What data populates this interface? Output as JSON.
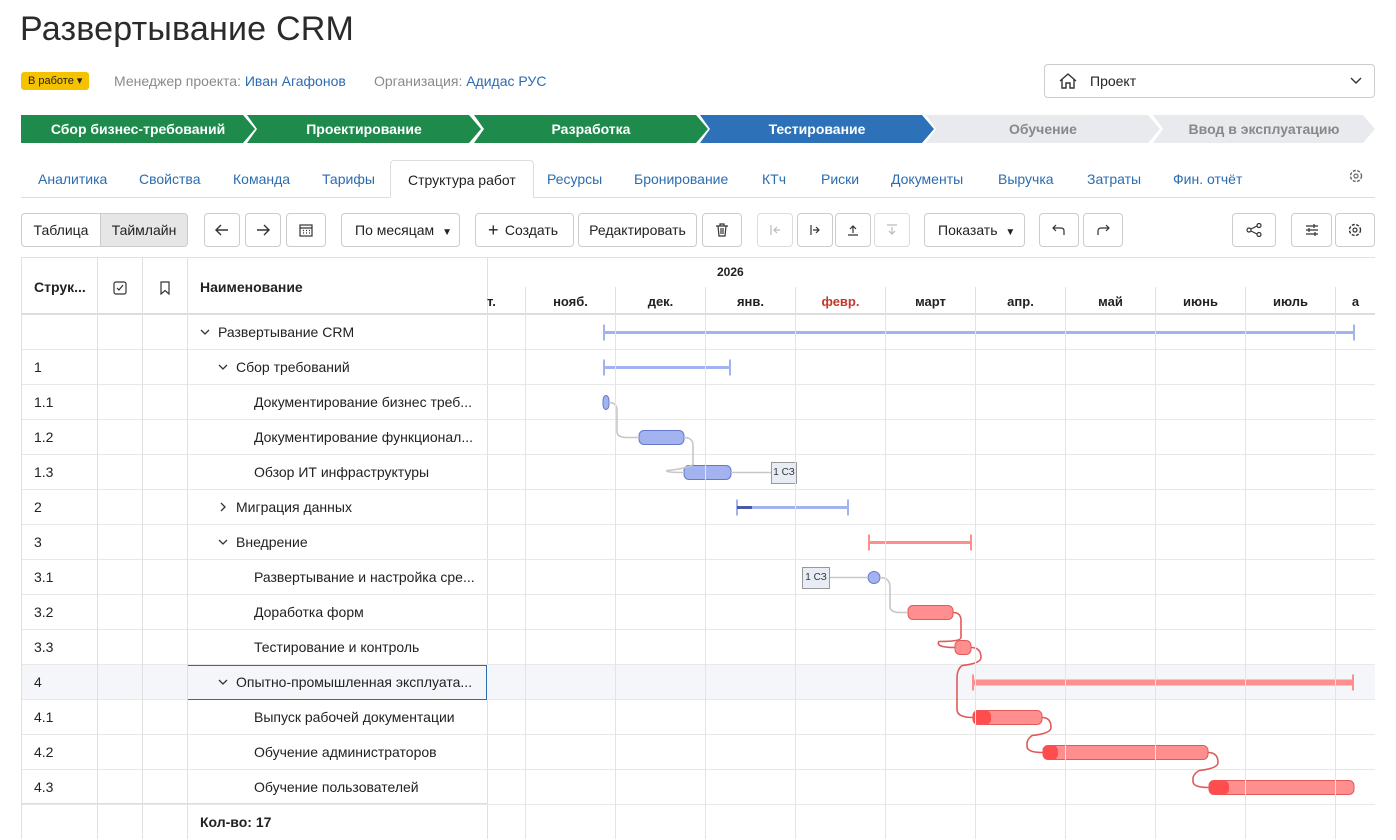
{
  "header": {
    "title": "Развертывание CRM",
    "status": "В работе",
    "manager_label": "Менеджер проекта:",
    "manager_name": "Иван Агафонов",
    "org_label": "Организация:",
    "org_name": "Адидас РУС",
    "project_select": "Проект"
  },
  "stages": [
    {
      "label": "Сбор бизнес-требований",
      "color": "#1e8a4c"
    },
    {
      "label": "Проектирование",
      "color": "#1e8a4c"
    },
    {
      "label": "Разработка",
      "color": "#1e8a4c"
    },
    {
      "label": "Тестирование",
      "color": "#2d72b8"
    },
    {
      "label": "Обучение",
      "color": "#e8eaed"
    },
    {
      "label": "Ввод в эксплуатацию",
      "color": "#e8eaed"
    }
  ],
  "tabs": [
    "Аналитика",
    "Свойства",
    "Команда",
    "Тарифы",
    "Структура работ",
    "Ресурсы",
    "Бронирование",
    "КТч",
    "Риски",
    "Документы",
    "Выручка",
    "Затраты",
    "Фин. отчёт"
  ],
  "active_tab": "Структура работ",
  "toolbar": {
    "view_table": "Таблица",
    "view_timeline": "Таймлайн",
    "scale": "По месяцам",
    "create": "Создать",
    "edit": "Редактировать",
    "show": "Показать"
  },
  "grid": {
    "col_struct": "Струк...",
    "col_name": "Наименование",
    "footer": "Кол-во: 17",
    "rows": [
      {
        "num": "",
        "name": "Развертывание CRM",
        "level": 0,
        "caret": "down"
      },
      {
        "num": "1",
        "name": "Сбор требований",
        "level": 1,
        "caret": "down"
      },
      {
        "num": "1.1",
        "name": "Документирование бизнес треб...",
        "level": 2,
        "caret": ""
      },
      {
        "num": "1.2",
        "name": "Документирование функционал...",
        "level": 2,
        "caret": ""
      },
      {
        "num": "1.3",
        "name": "Обзор ИТ инфраструктуры",
        "level": 2,
        "caret": ""
      },
      {
        "num": "2",
        "name": "Миграция данных",
        "level": 1,
        "caret": "right"
      },
      {
        "num": "3",
        "name": "Внедрение",
        "level": 1,
        "caret": "down"
      },
      {
        "num": "3.1",
        "name": "Развертывание и настройка сре...",
        "level": 2,
        "caret": ""
      },
      {
        "num": "3.2",
        "name": "Доработка форм",
        "level": 2,
        "caret": ""
      },
      {
        "num": "3.3",
        "name": "Тестирование и контроль",
        "level": 2,
        "caret": ""
      },
      {
        "num": "4",
        "name": "Опытно-промышленная эксплуата...",
        "level": 1,
        "caret": "down"
      },
      {
        "num": "4.1",
        "name": "Выпуск рабочей документации",
        "level": 2,
        "caret": ""
      },
      {
        "num": "4.2",
        "name": "Обучение администраторов",
        "level": 2,
        "caret": ""
      },
      {
        "num": "4.3",
        "name": "Обучение пользователей",
        "level": 2,
        "caret": ""
      }
    ]
  },
  "timeline": {
    "year": "2026",
    "months": [
      "т.",
      "нояб.",
      "дек.",
      "янв.",
      "февр.",
      "март",
      "апр.",
      "май",
      "июнь",
      "июль",
      "а"
    ],
    "highlight_month": "февр.",
    "milestone_label": "1 СЗ"
  }
}
